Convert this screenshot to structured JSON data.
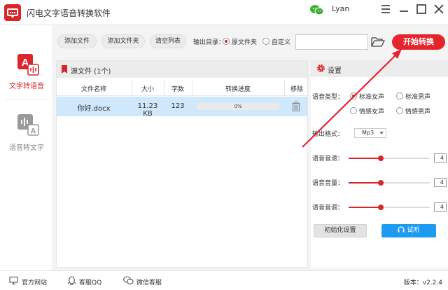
{
  "window": {
    "title": "闪电文字语音转换软件",
    "user": "Lyan"
  },
  "sidebar": {
    "items": [
      {
        "label": "文字转语音",
        "active": true
      },
      {
        "label": "语音转文字",
        "active": false
      }
    ]
  },
  "toolbar": {
    "add_file": "添加文件",
    "add_folder": "添加文件夹",
    "clear_list": "清空列表",
    "output_dir_label": "输出目录：",
    "option_source": "原文件夹",
    "option_custom": "自定义",
    "output_path": "",
    "start": "开始转换"
  },
  "files": {
    "header": "源文件 (1个)",
    "columns": [
      "文件名称",
      "大小",
      "字数",
      "转换进度",
      "移除"
    ],
    "rows": [
      {
        "name": "你好.docx",
        "size": "11.23 KB",
        "words": "123",
        "progress_text": "0%",
        "progress": 0
      }
    ]
  },
  "settings": {
    "title": "设置",
    "voice_type_label": "语音类型：",
    "voices": [
      "标准女声",
      "标准男声",
      "情感女声",
      "情感男声"
    ],
    "selected_voice": "标准女声",
    "format_label": "输出格式：",
    "format_value": "Mp3",
    "speed_label": "语音音速：",
    "speed_value": "4",
    "volume_label": "语音音量：",
    "volume_value": "4",
    "pitch_label": "语音音调：",
    "pitch_value": "4",
    "slider_max": 10,
    "init_button": "初始化设置",
    "listen_button": "试听"
  },
  "footer": {
    "website": "官方网站",
    "qq": "客服QQ",
    "wechat": "微信客服",
    "version": "版本：v2.2.4"
  },
  "colors": {
    "accent": "#d9262b",
    "listen": "#1e9bf0",
    "selected_row": "#cfe8fb",
    "wechat_green": "#3cb034"
  }
}
